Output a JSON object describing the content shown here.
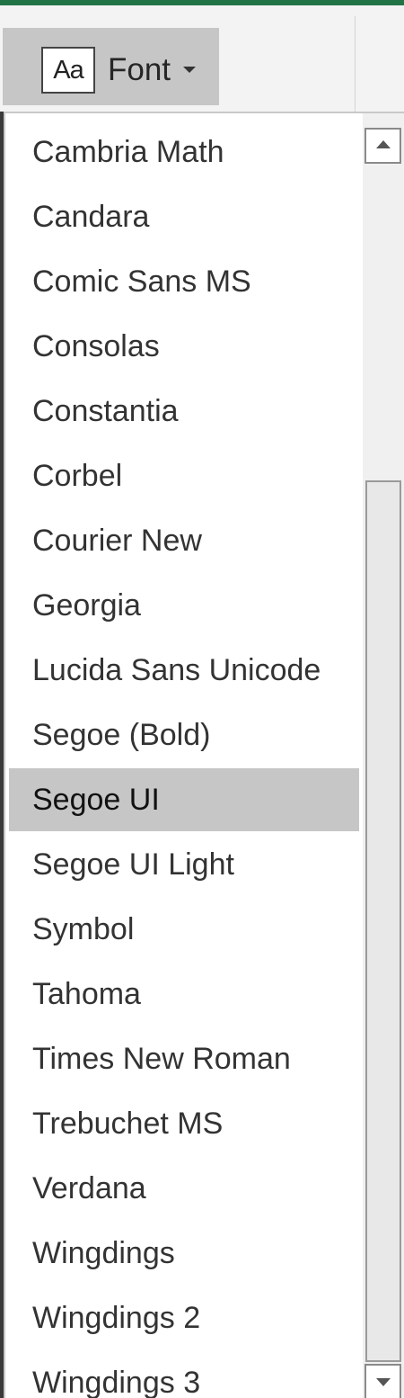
{
  "ribbon": {
    "font_button": {
      "icon_text": "Aa",
      "label": "Font",
      "icon": "font-aa-icon"
    }
  },
  "font_menu": {
    "selected": "Segoe UI",
    "items": [
      {
        "label": "Cambria Math"
      },
      {
        "label": "Candara"
      },
      {
        "label": "Comic Sans MS"
      },
      {
        "label": "Consolas"
      },
      {
        "label": "Constantia"
      },
      {
        "label": "Corbel"
      },
      {
        "label": "Courier New"
      },
      {
        "label": "Georgia"
      },
      {
        "label": "Lucida Sans Unicode"
      },
      {
        "label": "Segoe (Bold)"
      },
      {
        "label": "Segoe UI"
      },
      {
        "label": "Segoe UI Light"
      },
      {
        "label": "Symbol"
      },
      {
        "label": "Tahoma"
      },
      {
        "label": "Times New Roman"
      },
      {
        "label": "Trebuchet MS"
      },
      {
        "label": "Verdana"
      },
      {
        "label": "Wingdings"
      },
      {
        "label": "Wingdings 2"
      },
      {
        "label": "Wingdings 3"
      }
    ]
  },
  "colors": {
    "accent": "#217346",
    "selection": "#c6c6c6"
  }
}
